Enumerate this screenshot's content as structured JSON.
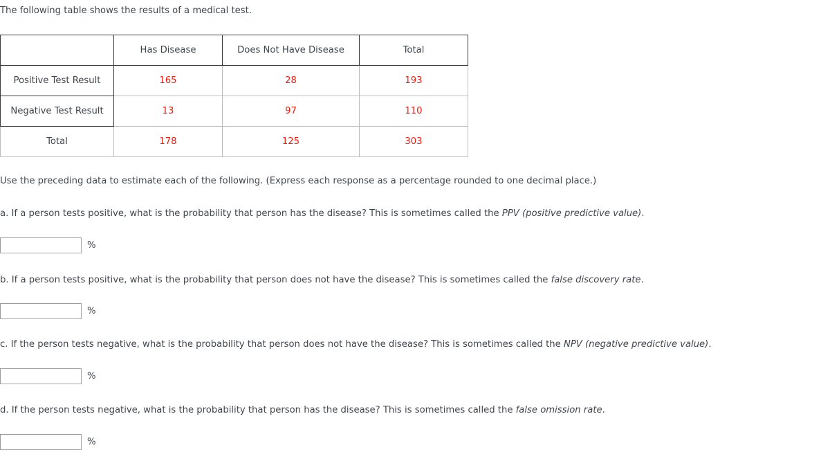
{
  "intro": {
    "text": "The following table shows the results of a medical test."
  },
  "table": {
    "columns": [
      "",
      "Has Disease",
      "Does Not Have Disease",
      "Total"
    ],
    "rows": [
      {
        "label": "Positive Test Result",
        "values": [
          "165",
          "28",
          "193"
        ]
      },
      {
        "label": "Negative Test Result",
        "values": [
          "13",
          "97",
          "110"
        ]
      },
      {
        "label": "Total",
        "values": [
          "178",
          "125",
          "303"
        ]
      }
    ],
    "number_color": "#ec1c10",
    "border_dark": "#3a3a3a",
    "border_light": "#bdbdbd"
  },
  "instruction": {
    "text": "Use the preceding data to estimate each of the following. (Express each response as a percentage rounded to one decimal place.)"
  },
  "questions": [
    {
      "letter": "a.",
      "lead": "a. If a person tests positive, what is the probability that person has the disease? This is sometimes called the ",
      "emphasis": "PPV (positive predictive value)",
      "trail": ".",
      "input_value": "",
      "input_placeholder": "",
      "unit": "%"
    },
    {
      "letter": "b.",
      "lead": "b. If a person tests positive, what is the probability that person does not have the disease? This is sometimes called the ",
      "emphasis": "false discovery rate",
      "trail": ".",
      "input_value": "",
      "input_placeholder": "",
      "unit": "%"
    },
    {
      "letter": "c.",
      "lead": "c. If the person tests negative, what is the probability that person does not have the disease? This is sometimes called the ",
      "emphasis": "NPV (negative predictive value)",
      "trail": ".",
      "input_value": "",
      "input_placeholder": "",
      "unit": "%"
    },
    {
      "letter": "d.",
      "lead": "d. If the person tests negative, what is the probability that person has the disease? This is sometimes called the ",
      "emphasis": "false omission rate",
      "trail": ".",
      "input_value": "",
      "input_placeholder": "",
      "unit": "%"
    }
  ]
}
